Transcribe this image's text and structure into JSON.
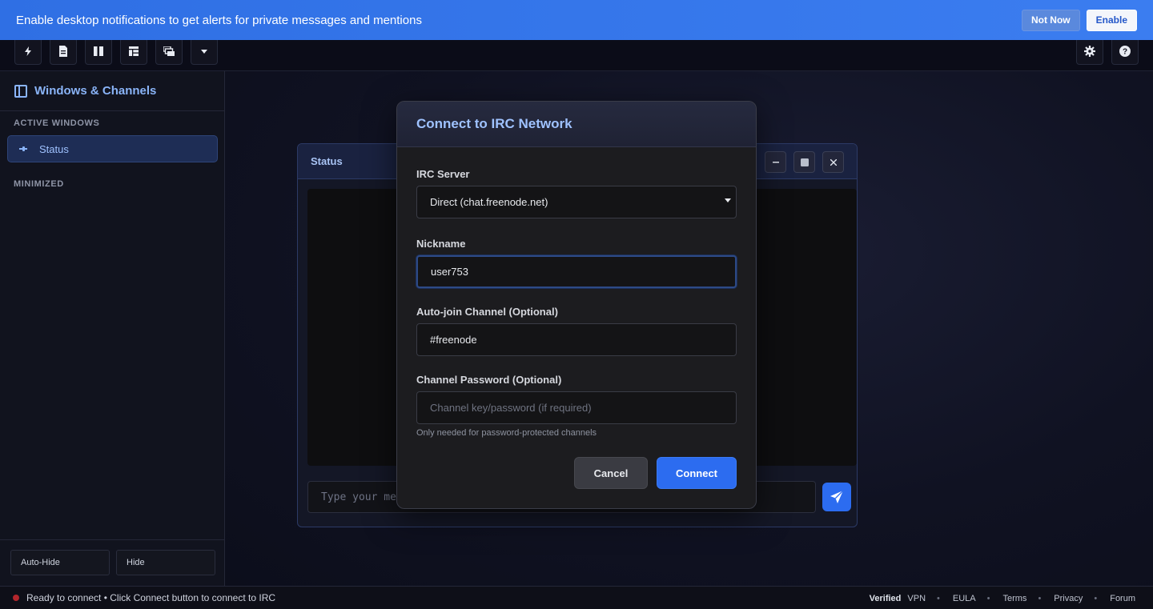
{
  "notification": {
    "message": "Enable desktop notifications to get alerts for private messages and mentions",
    "not_now_label": "Not Now",
    "enable_label": "Enable"
  },
  "toolbar": {
    "left_buttons": [
      "lightning-icon",
      "document-icon",
      "columns-icon",
      "layout-icon",
      "cascade-windows-icon",
      "dropdown-caret-icon"
    ],
    "right_buttons": [
      "settings-gear-icon",
      "help-icon"
    ]
  },
  "sidebar": {
    "title": "Windows & Channels",
    "active_section": "ACTIVE WINDOWS",
    "items": [
      {
        "label": "Status"
      }
    ],
    "minimized_section": "MINIMIZED",
    "auto_hide_label": "Auto-Hide",
    "hide_label": "Hide"
  },
  "status_window": {
    "title": "Status",
    "input_placeholder": "Type your me",
    "controls": [
      "minimize-icon",
      "maximize-icon",
      "close-icon"
    ]
  },
  "modal": {
    "title": "Connect to IRC Network",
    "server_label": "IRC Server",
    "server_value": "Direct (chat.freenode.net)",
    "nickname_label": "Nickname",
    "nickname_value": "user753",
    "autojoin_label": "Auto-join Channel (Optional)",
    "autojoin_value": "#freenode",
    "password_label": "Channel Password (Optional)",
    "password_placeholder": "Channel key/password (if required)",
    "password_hint": "Only needed for password-protected channels",
    "cancel_label": "Cancel",
    "connect_label": "Connect"
  },
  "statusbar": {
    "message": "Ready to connect • Click Connect button to connect to IRC",
    "status_color": "#b3262c",
    "links": [
      "Verified",
      "VPN",
      "EULA",
      "Terms",
      "Privacy",
      "Forum"
    ]
  },
  "colors": {
    "accent": "#2c6cf0",
    "banner": "#3b7df0",
    "title_text": "#9fc2ff"
  }
}
